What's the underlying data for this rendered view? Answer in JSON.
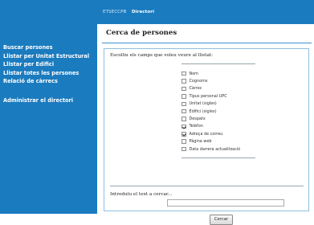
{
  "header": {
    "breadcrumb_root": "ETSECCPB",
    "breadcrumb_current": "Directori"
  },
  "sidebar": {
    "items": [
      {
        "label": "Buscar persones"
      },
      {
        "label": "Llistar per Unitat Estructural"
      },
      {
        "label": "Llistar per Edifici"
      },
      {
        "label": "Llistar totes les persones"
      },
      {
        "label": "Relació de càrrecs"
      }
    ],
    "admin_label": "Administrar el directori"
  },
  "main": {
    "title": "Cerca de persones",
    "fields_header": "Escolliu els camps que voleu veure al llistat:",
    "fields": [
      {
        "label": "Nom",
        "checked": false
      },
      {
        "label": "Cognoms",
        "checked": false
      },
      {
        "label": "Càrrec",
        "checked": false
      },
      {
        "label": "Tipus personal UPC",
        "checked": false
      },
      {
        "label": "Unitat (sigles)",
        "checked": false
      },
      {
        "label": "Edifici (sigles)",
        "checked": false
      },
      {
        "label": "Despatx",
        "checked": false
      },
      {
        "label": "Telèfon",
        "checked": true
      },
      {
        "label": "Adreça de correu",
        "checked": true
      },
      {
        "label": "Pàgina web",
        "checked": false
      },
      {
        "label": "Data darrera actualització",
        "checked": false
      }
    ],
    "search_label": "Introduïu el text a cercar...",
    "search_value": "",
    "search_button": "Cercar"
  },
  "colors": {
    "sidebar_bg": "#1b7bbf",
    "accent_rule": "#3b8fcd",
    "panel_border": "#8fbfe2"
  }
}
